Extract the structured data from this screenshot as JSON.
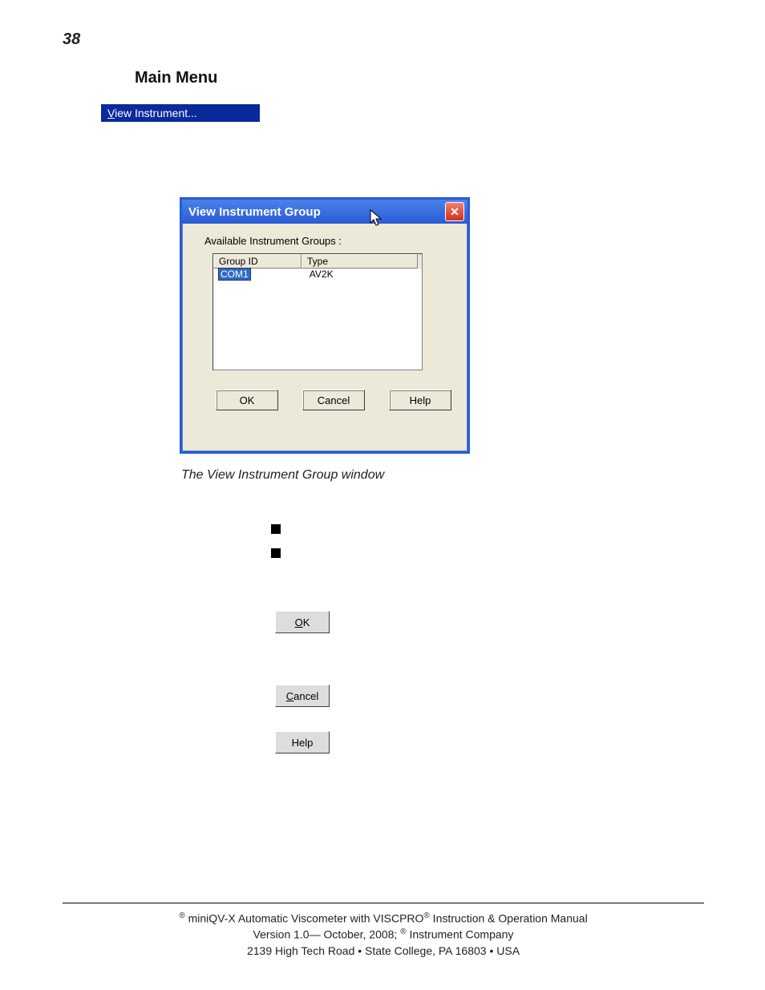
{
  "page_number": "38",
  "heading": "Main Menu",
  "menu_item": {
    "prefix_letter": "V",
    "rest": "iew Instrument..."
  },
  "dialog": {
    "title": "View Instrument Group",
    "close_glyph": "✕",
    "available_label": "Available Instrument Groups :",
    "columns": {
      "group_id": "Group ID",
      "type": "Type"
    },
    "row": {
      "group_id": "COM1",
      "type": "AV2K"
    },
    "buttons": {
      "ok": "OK",
      "cancel": "Cancel",
      "help": "Help"
    }
  },
  "caption": "The View Instrument Group window",
  "inline_buttons": {
    "ok_prefix": "O",
    "ok_rest": "K",
    "cancel_prefix": "C",
    "cancel_rest": "ancel",
    "help": "Help"
  },
  "footer": {
    "line1a": " miniQV-X Automatic Viscometer with VISCPRO",
    "line1b": " Instruction & Operation Manual",
    "line2a": "Version 1.0— October, 2008; ",
    "line2b": " Instrument Company",
    "line3": "2139 High Tech Road • State College, PA  16803 • USA",
    "reg": "®"
  }
}
